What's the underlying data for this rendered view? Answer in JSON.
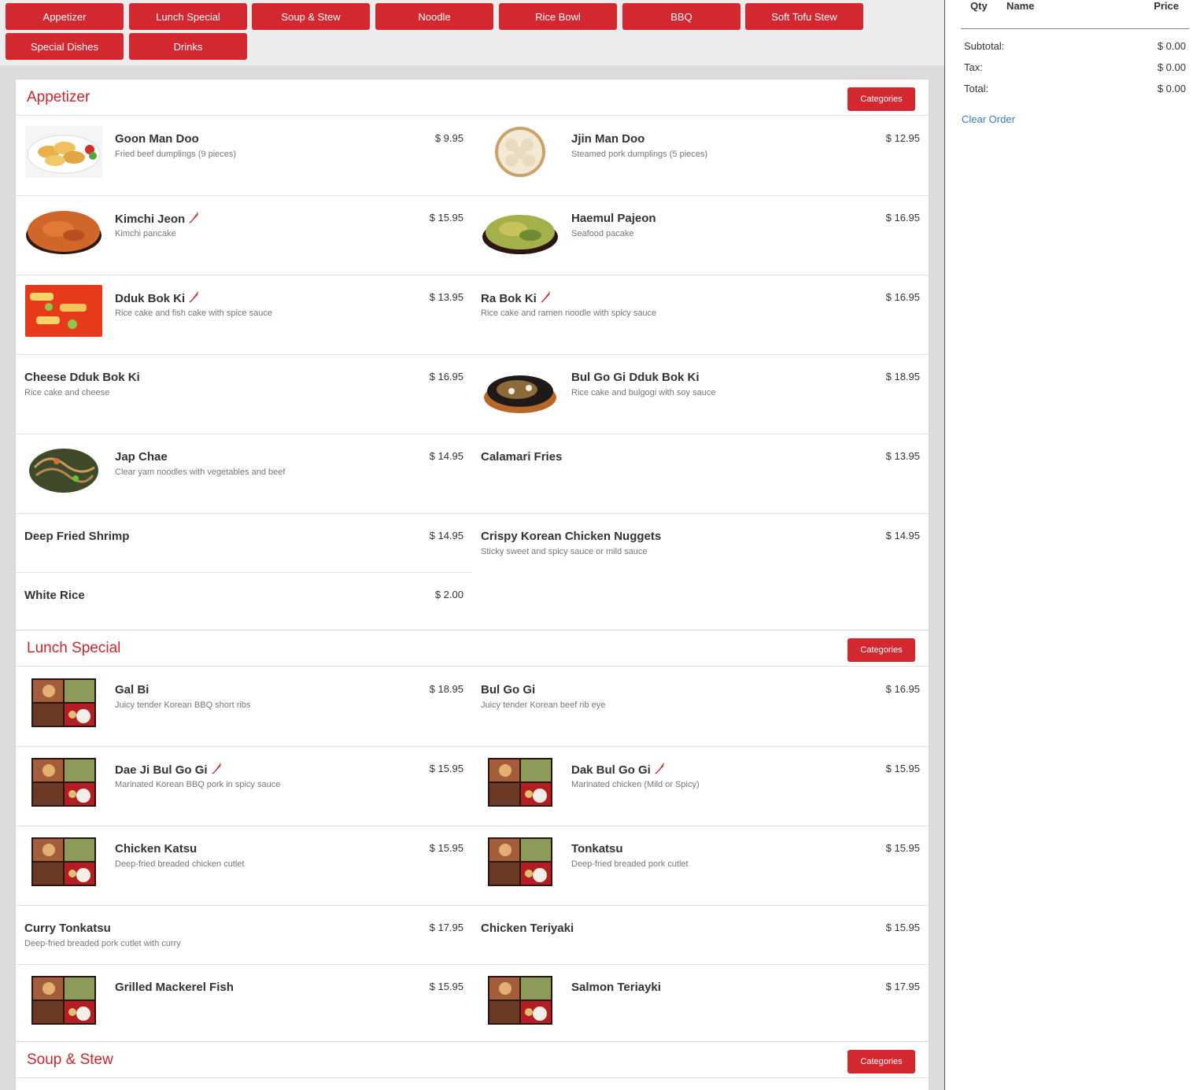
{
  "categories": [
    "Appetizer",
    "Lunch Special",
    "Soup & Stew",
    "Noodle",
    "Rice Bowl",
    "BBQ",
    "Soft Tofu Stew",
    "Special Dishes",
    "Drinks"
  ],
  "categories_button_label": "Categories",
  "sections": {
    "appetizer": {
      "title": "Appetizer",
      "items": [
        {
          "name": "Goon Man Doo",
          "desc": "Fried beef dumplings (9 pieces)",
          "price": "$ 9.95"
        },
        {
          "name": "Jjin Man Doo",
          "desc": "Steamed pork dumplings (5 pieces)",
          "price": "$ 12.95"
        },
        {
          "name": "Kimchi Jeon",
          "desc": "Kimchi pancake",
          "price": "$ 15.95",
          "spicy": true
        },
        {
          "name": "Haemul Pajeon",
          "desc": "Seafood pacake",
          "price": "$ 16.95"
        },
        {
          "name": "Dduk Bok Ki",
          "desc": "Rice cake and fish cake with spice sauce",
          "price": "$ 13.95",
          "spicy": true
        },
        {
          "name": "Ra Bok Ki",
          "desc": "Rice cake and ramen noodle with spicy sauce",
          "price": "$ 16.95",
          "spicy": true
        },
        {
          "name": "Cheese Dduk Bok Ki",
          "desc": "Rice cake and cheese",
          "price": "$ 16.95"
        },
        {
          "name": "Bul Go Gi Dduk Bok Ki",
          "desc": "Rice cake and bulgogi with soy sauce",
          "price": "$ 18.95"
        },
        {
          "name": "Jap Chae",
          "desc": "Clear yam noodles with vegetables and beef",
          "price": "$ 14.95"
        },
        {
          "name": "Calamari Fries",
          "desc": "",
          "price": "$ 13.95"
        },
        {
          "name": "Deep Fried Shrimp",
          "desc": "",
          "price": "$ 14.95"
        },
        {
          "name": "Crispy Korean Chicken Nuggets",
          "desc": "Sticky sweet and spicy sauce or mild sauce",
          "price": "$ 14.95"
        },
        {
          "name": "White Rice",
          "desc": "",
          "price": "$ 2.00"
        }
      ]
    },
    "lunch": {
      "title": "Lunch Special",
      "items": [
        {
          "name": "Gal Bi",
          "desc": "Juicy tender Korean BBQ short ribs",
          "price": "$ 18.95"
        },
        {
          "name": "Bul Go Gi",
          "desc": "Juicy tender Korean beef rib eye",
          "price": "$ 16.95"
        },
        {
          "name": "Dae Ji Bul Go Gi",
          "desc": "Marinated Korean BBQ pork in spicy sauce",
          "price": "$ 15.95",
          "spicy": true
        },
        {
          "name": "Dak Bul Go Gi",
          "desc": "Marinated chicken (Mild or Spicy)",
          "price": "$ 15.95",
          "spicy": true
        },
        {
          "name": "Chicken Katsu",
          "desc": "Deep-fried breaded chicken cutlet",
          "price": "$ 15.95"
        },
        {
          "name": "Tonkatsu",
          "desc": "Deep-fried breaded pork cutlet",
          "price": "$ 15.95"
        },
        {
          "name": "Curry Tonkatsu",
          "desc": "Deep-fried breaded pork cutlet with curry",
          "price": "$ 17.95"
        },
        {
          "name": "Chicken Teriyaki",
          "desc": "",
          "price": "$ 15.95"
        },
        {
          "name": "Grilled Mackerel Fish",
          "desc": "",
          "price": "$ 15.95"
        },
        {
          "name": "Salmon Teriayki",
          "desc": "",
          "price": "$ 17.95"
        }
      ]
    },
    "soup": {
      "title": "Soup & Stew"
    }
  },
  "order": {
    "col_qty": "Qty",
    "col_name": "Name",
    "col_price": "Price",
    "subtotal_label": "Subtotal:",
    "subtotal_value": "$ 0.00",
    "tax_label": "Tax:",
    "tax_value": "$ 0.00",
    "total_label": "Total:",
    "total_value": "$ 0.00",
    "clear_label": "Clear Order"
  },
  "colors": {
    "accent_red": "#d3282f",
    "title_red": "#c9272d",
    "link_blue": "#3a7bbf"
  }
}
